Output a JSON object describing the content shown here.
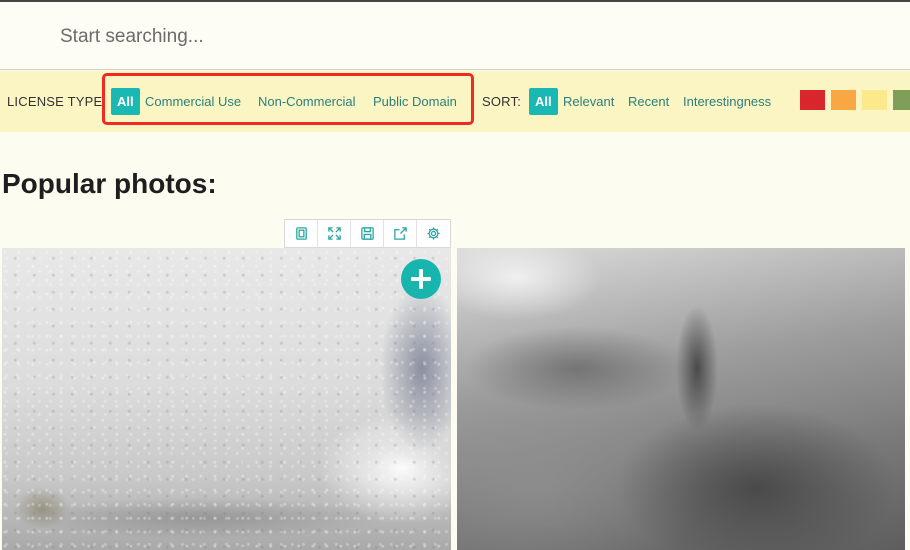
{
  "search": {
    "placeholder": "Start searching..."
  },
  "filters": {
    "license_label": "LICENSE TYPE:",
    "license_options": [
      "All",
      "Commercial Use",
      "Non-Commercial",
      "Public Domain"
    ],
    "license_selected": "All",
    "sort_label": "SORT:",
    "sort_options": [
      "All",
      "Relevant",
      "Recent",
      "Interestingness"
    ],
    "sort_selected": "All",
    "color_swatches": [
      "#d9262c",
      "#f9a644",
      "#fbe98c",
      "#7f9e58"
    ]
  },
  "section": {
    "title": "Popular photos:"
  },
  "toolbar": {
    "icons": [
      "collection-icon",
      "fullscreen-icon",
      "save-icon",
      "share-icon",
      "settings-icon"
    ]
  },
  "accent_color": "#1ab8b3",
  "highlight_color": "#f02a22"
}
